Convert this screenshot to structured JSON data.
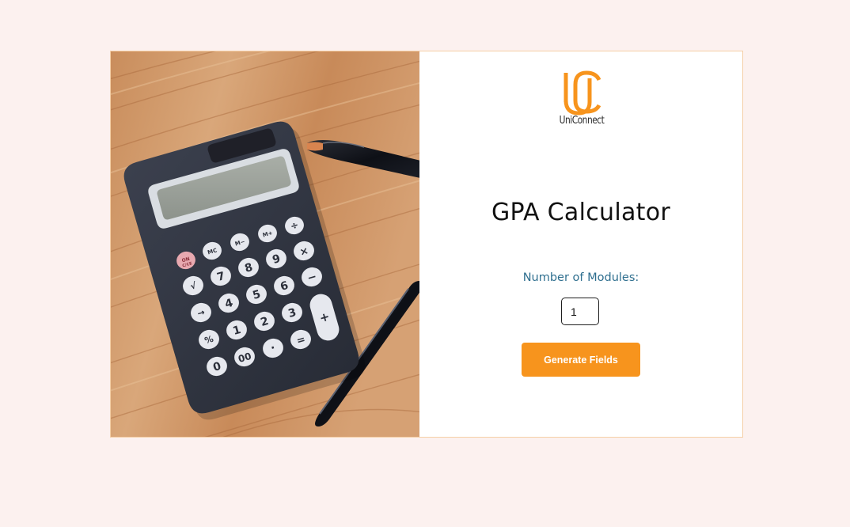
{
  "brand": {
    "name": "UniConnect",
    "accent_color": "#f7941d"
  },
  "hero_image": {
    "subject": "calculator-and-pen-on-wood-desk",
    "calculator_keys": [
      "ON C/CE",
      "MC/MR",
      "M−",
      "M+",
      "÷",
      "√",
      "7",
      "8",
      "9",
      "×",
      "→",
      "4",
      "5",
      "6",
      "−",
      "%",
      "1",
      "2",
      "3",
      "+",
      "0",
      "00",
      "·",
      "="
    ]
  },
  "form": {
    "title": "GPA Calculator",
    "modules_label": "Number of Modules:",
    "modules_value": "1",
    "generate_label": "Generate Fields"
  }
}
